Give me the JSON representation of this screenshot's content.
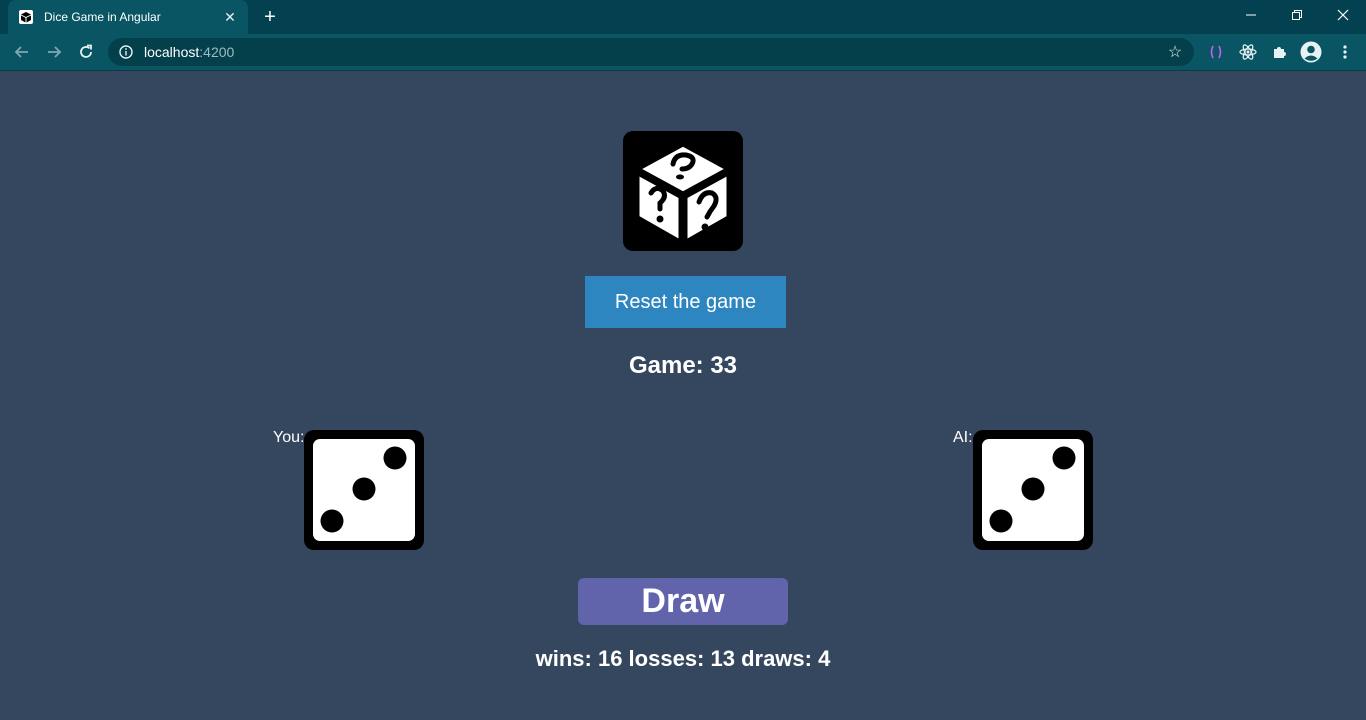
{
  "browser": {
    "tab_title": "Dice Game in Angular",
    "url_host": "localhost",
    "url_port": ":4200",
    "colors": {
      "frame": "#044150",
      "toolbar": "#0a5563",
      "omnibox": "#043f4c"
    }
  },
  "game": {
    "reset_label": "Reset the game",
    "game_label": "Game: 33",
    "you_label": "You:",
    "ai_label": "AI:",
    "you_die_value": 3,
    "ai_die_value": 3,
    "result_label": "Draw",
    "score_text": "wins: 16 losses: 13 draws: 4",
    "colors": {
      "background": "#35475e",
      "reset_button": "#2e86c1",
      "result_button": "#6163ab"
    }
  }
}
